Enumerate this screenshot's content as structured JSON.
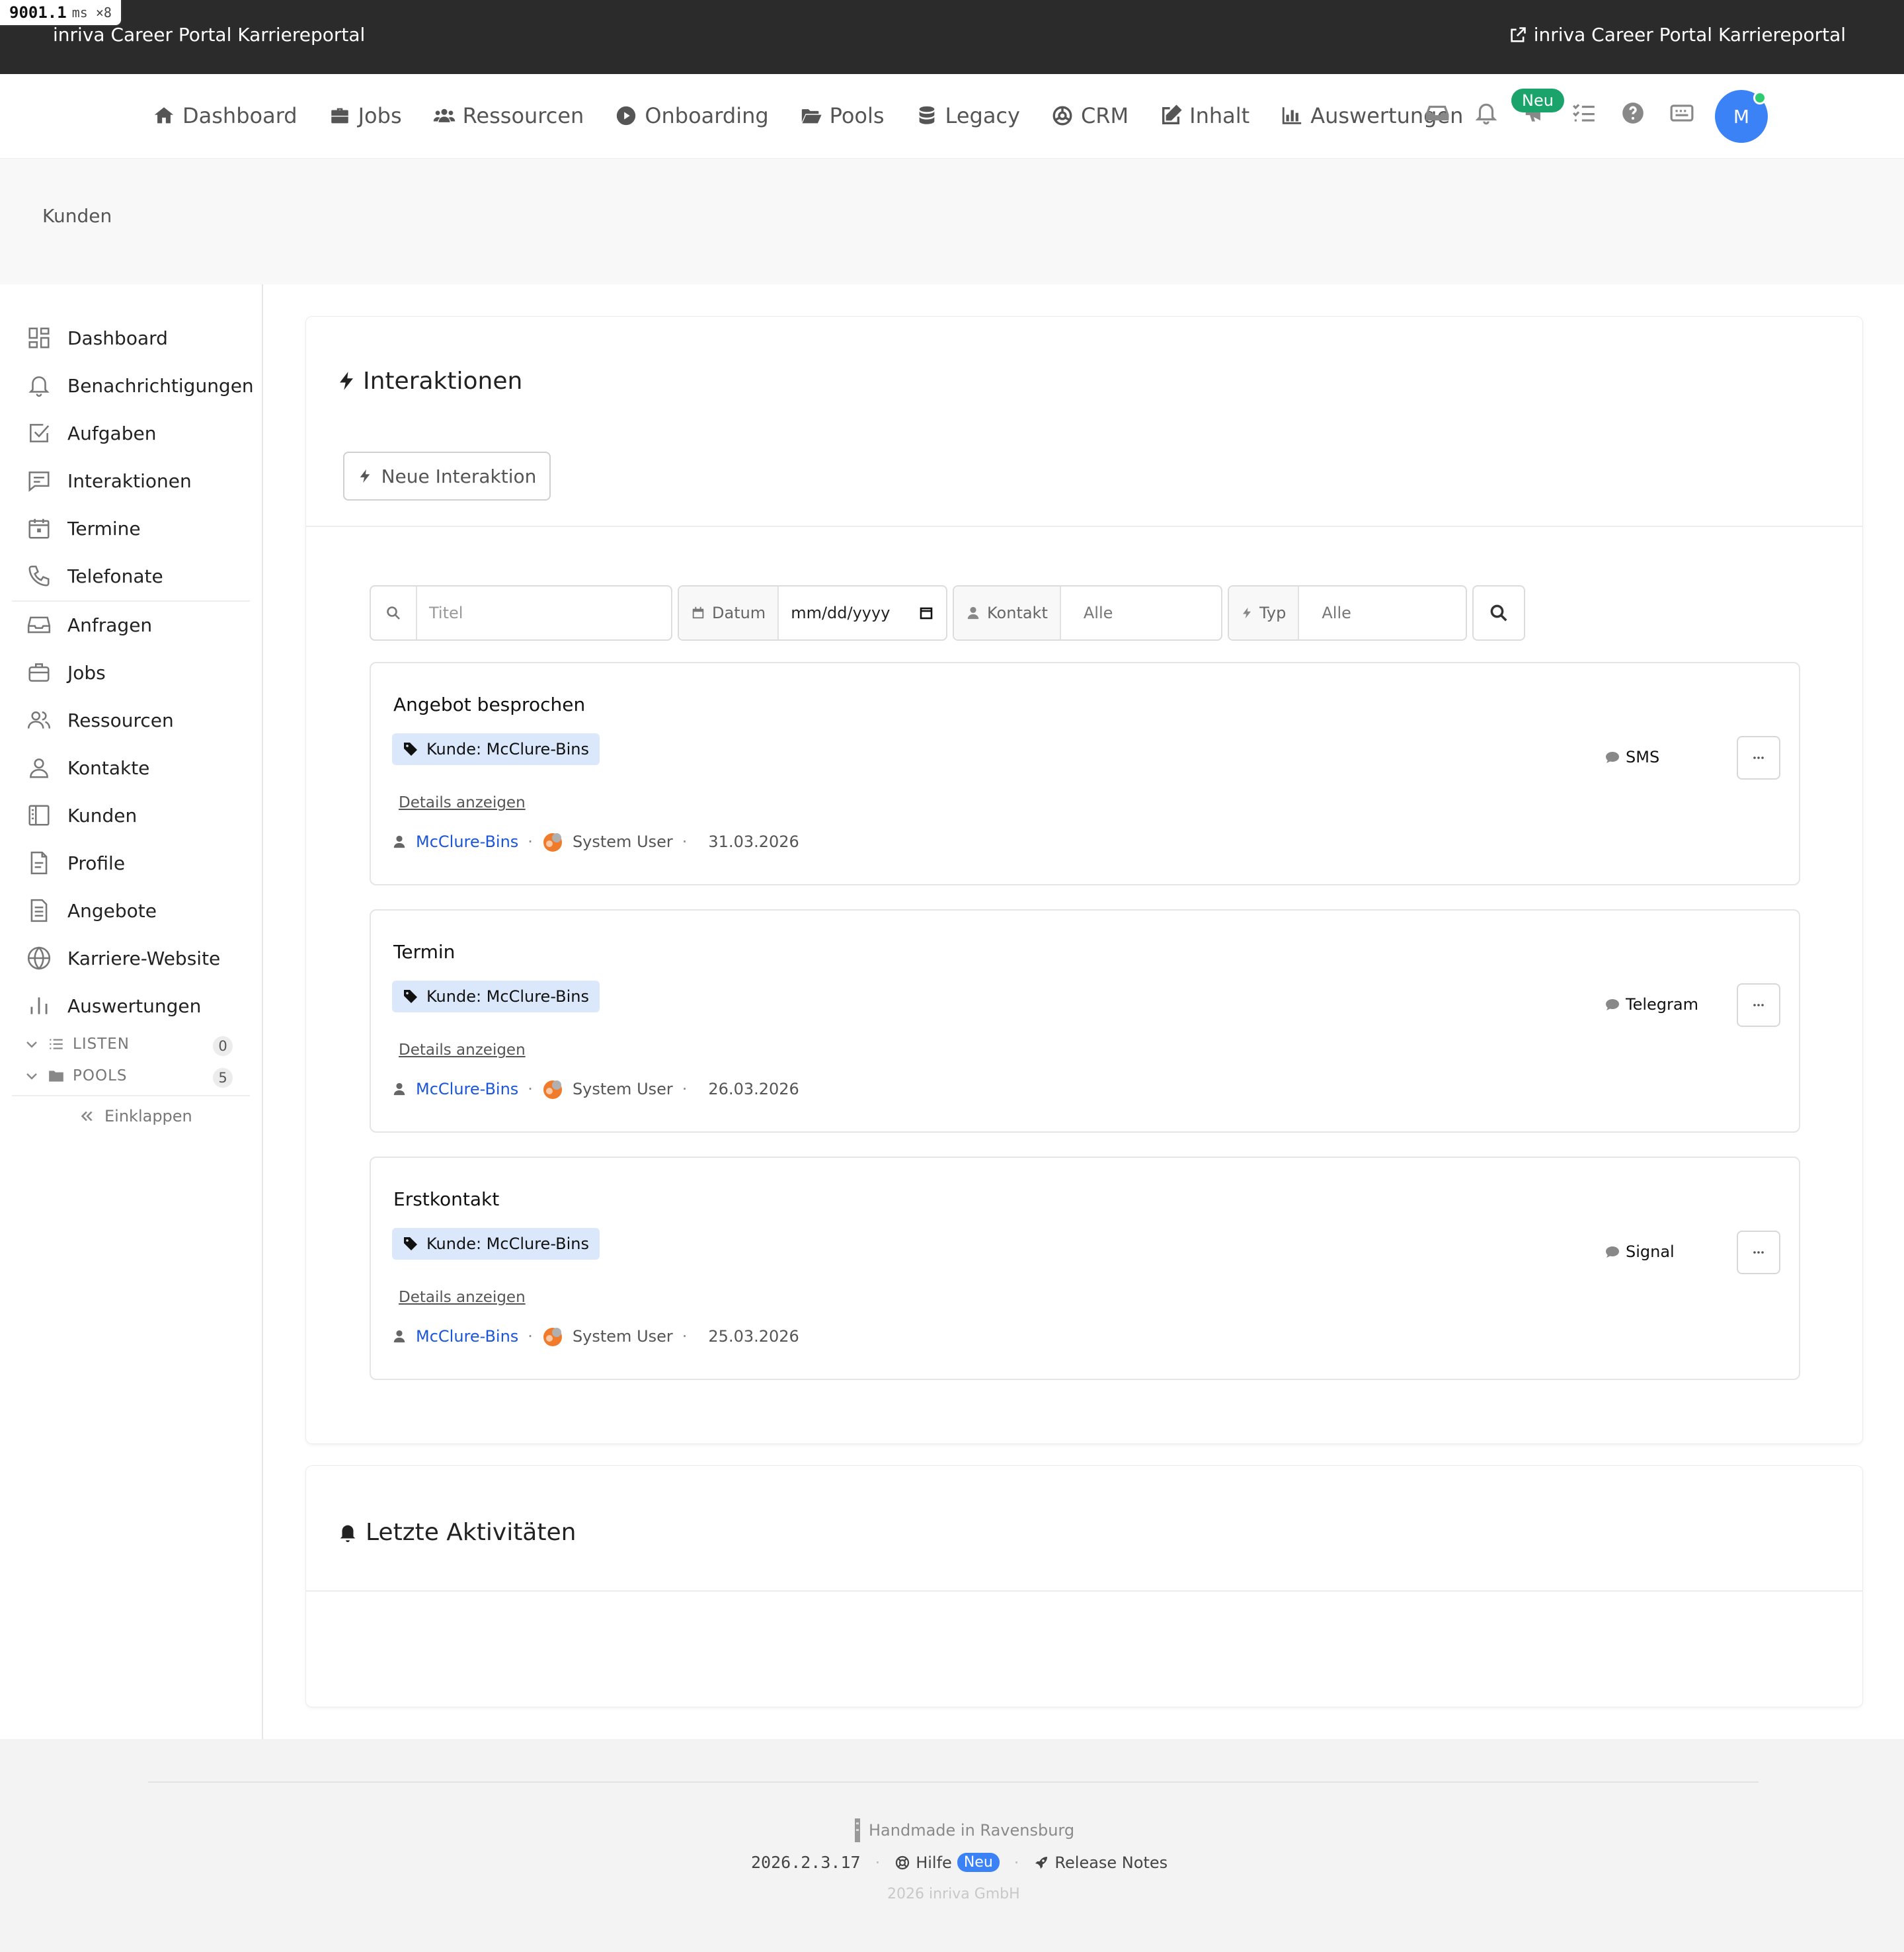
{
  "perf": {
    "value": "9001.1",
    "unit": "ms ×8"
  },
  "topbar": {
    "brand": "inriva Career Portal Karriereportal",
    "external_link": "inriva Career Portal Karriereportal"
  },
  "nav": {
    "items": [
      {
        "label": "Dashboard",
        "icon": "home-icon"
      },
      {
        "label": "Jobs",
        "icon": "briefcase-icon"
      },
      {
        "label": "Ressourcen",
        "icon": "users-icon"
      },
      {
        "label": "Onboarding",
        "icon": "play-circle-icon"
      },
      {
        "label": "Pools",
        "icon": "folder-open-icon"
      },
      {
        "label": "Legacy",
        "icon": "database-icon"
      },
      {
        "label": "CRM",
        "icon": "crm-icon"
      },
      {
        "label": "Inhalt",
        "icon": "edit-icon"
      },
      {
        "label": "Auswertungen",
        "icon": "bar-chart-icon"
      }
    ],
    "neu_badge": "Neu",
    "avatar_initial": "M"
  },
  "breadcrumb": "Kunden",
  "sidebar": {
    "items": [
      {
        "label": "Dashboard",
        "icon": "dashboard-icon"
      },
      {
        "label": "Benachrichtigungen",
        "icon": "bell-icon"
      },
      {
        "label": "Aufgaben",
        "icon": "checkbox-icon"
      },
      {
        "label": "Interaktionen",
        "icon": "message-icon"
      },
      {
        "label": "Termine",
        "icon": "calendar-icon"
      },
      {
        "label": "Telefonate",
        "icon": "phone-icon"
      },
      {
        "label": "Anfragen",
        "icon": "inbox-icon"
      },
      {
        "label": "Jobs",
        "icon": "briefcase-icon"
      },
      {
        "label": "Ressourcen",
        "icon": "users-icon"
      },
      {
        "label": "Kontakte",
        "icon": "user-icon"
      },
      {
        "label": "Kunden",
        "icon": "building-icon"
      },
      {
        "label": "Profile",
        "icon": "file-icon"
      },
      {
        "label": "Angebote",
        "icon": "document-icon"
      },
      {
        "label": "Karriere-Website",
        "icon": "globe-icon"
      },
      {
        "label": "Auswertungen",
        "icon": "chart-icon"
      }
    ],
    "groups": [
      {
        "label": "LISTEN",
        "count": "0"
      },
      {
        "label": "POOLS",
        "count": "5"
      }
    ],
    "collapse_label": "Einklappen"
  },
  "interactions": {
    "title": "Interaktionen",
    "new_button": "Neue Interaktion",
    "filters": {
      "title_placeholder": "Titel",
      "date_label": "Datum",
      "date_value": "mm/dd/yyyy",
      "contact_label": "Kontakt",
      "contact_value": "Alle",
      "type_label": "Typ",
      "type_value": "Alle"
    },
    "items": [
      {
        "title": "Angebot besprochen",
        "tag": "Kunde: McClure-Bins",
        "details": "Details anzeigen",
        "contact": "McClure-Bins",
        "user": "System User",
        "date": "31.03.2026",
        "channel": "SMS"
      },
      {
        "title": "Termin",
        "tag": "Kunde: McClure-Bins",
        "details": "Details anzeigen",
        "contact": "McClure-Bins",
        "user": "System User",
        "date": "26.03.2026",
        "channel": "Telegram"
      },
      {
        "title": "Erstkontakt",
        "tag": "Kunde: McClure-Bins",
        "details": "Details anzeigen",
        "contact": "McClure-Bins",
        "user": "System User",
        "date": "25.03.2026",
        "channel": "Signal"
      }
    ]
  },
  "activities": {
    "title": "Letzte Aktivitäten"
  },
  "footer": {
    "handmade": "Handmade in Ravensburg",
    "version": "2026.2.3.17",
    "help": "Hilfe",
    "help_badge": "Neu",
    "release_notes": "Release Notes",
    "copyright": "2026 inriva GmbH"
  },
  "colors": {
    "topbar_bg": "#2b2b2b",
    "accent_blue": "#3b82f6",
    "link_blue": "#1a56db",
    "tag_bg": "#dbe8fb",
    "success_green": "#1aa36a"
  }
}
